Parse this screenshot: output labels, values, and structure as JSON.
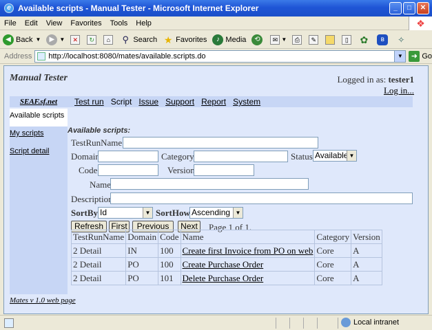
{
  "window": {
    "title": "Available scripts - Manual Tester - Microsoft Internet Explorer"
  },
  "menu": [
    "File",
    "Edit",
    "View",
    "Favorites",
    "Tools",
    "Help"
  ],
  "toolbar": {
    "back": "Back",
    "search": "Search",
    "favorites": "Favorites",
    "media": "Media"
  },
  "address": {
    "label": "Address",
    "url": "http://localhost:8080/mates/available.scripts.do",
    "go": "Go"
  },
  "header": {
    "app_title": "Manual Tester",
    "logged_prefix": "Logged in as:",
    "user": "tester1",
    "login": "Log in..."
  },
  "nav": {
    "brand": "SEAF.sf.net",
    "items": [
      "Test run",
      "Script",
      "Issue",
      "Support",
      "Report",
      "System"
    ]
  },
  "sidebar": [
    "Available scripts",
    "My scripts",
    "Script detail"
  ],
  "form": {
    "title": "Available scripts:",
    "testrunname": "TestRunName",
    "domain": "Domain",
    "category": "Category",
    "status": "Status",
    "status_value": "Available",
    "code": "Code",
    "version": "Version",
    "name": "Name",
    "description": "Description",
    "sortby": "SortBy",
    "sortby_value": "Id",
    "sorthow": "SortHow",
    "sorthow_value": "Ascending",
    "refresh": "Refresh",
    "first": "First",
    "previous": "Previous",
    "next": "Next",
    "pageinfo": "Page 1 of 1."
  },
  "table": {
    "headers": [
      "TestRunName",
      "Domain",
      "Code",
      "Name",
      "Category",
      "Version"
    ],
    "rows": [
      [
        "2 Detail",
        "IN",
        "100",
        "Create first Invoice from PO on web",
        "Core",
        "A"
      ],
      [
        "2 Detail",
        "PO",
        "100",
        "Create Purchase Order",
        "Core",
        "A"
      ],
      [
        "2 Detail",
        "PO",
        "101",
        "Delete Purchase Order",
        "Core",
        "A"
      ]
    ]
  },
  "footer": "Mates v 1.0 web page",
  "status": {
    "zone": "Local intranet"
  }
}
